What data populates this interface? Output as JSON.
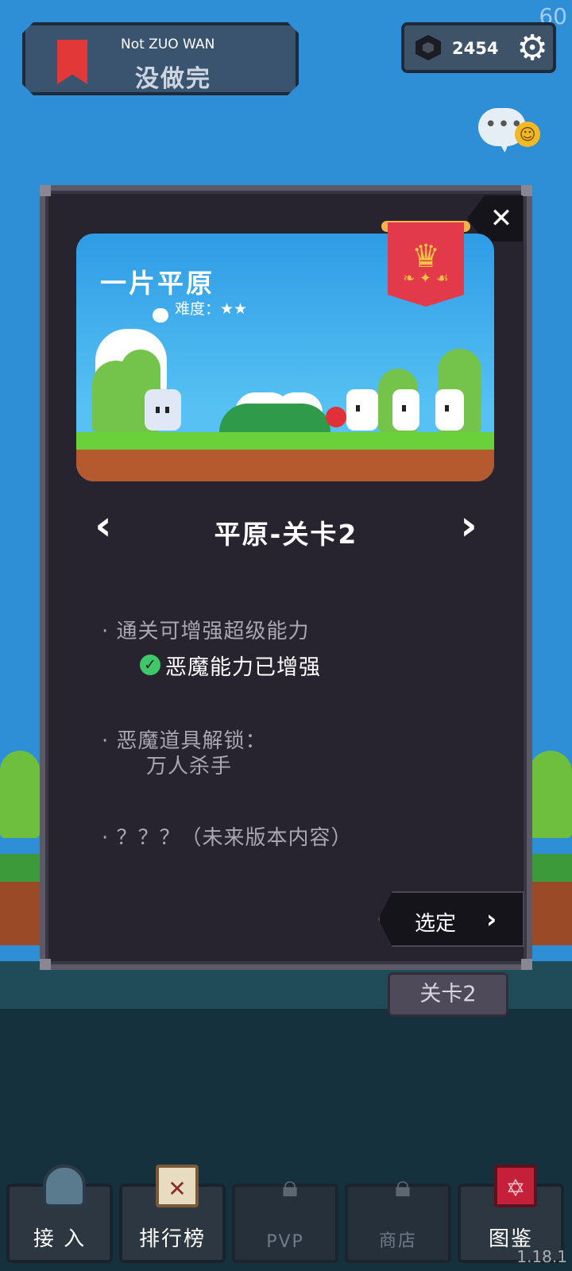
{
  "status": {
    "fps": "60",
    "version": "1.18.1"
  },
  "header": {
    "title_en": "Not ZUO WAN",
    "title_cn": "没做完",
    "bookmark_icon": "bookmark-icon",
    "currency": {
      "icon": "gem-icon",
      "amount": "2454"
    },
    "settings_icon": "gear-icon",
    "chat": {
      "dots": "•••",
      "emoji": "☺"
    }
  },
  "modal": {
    "close_label": "✕",
    "scene_title": "一片平原",
    "difficulty": "难度：★★",
    "badge_icon": "crown-banner-icon",
    "prev_label": "‹",
    "next_label": "›",
    "stage_name": "平原-关卡2",
    "rewards": [
      {
        "bullet": "· 通关可增强超级能力",
        "sub": "恶魔能力已增强"
      },
      {
        "bullet": "· 恶魔道具解锁：",
        "sub": "万人杀手"
      },
      {
        "bullet": "· ？？？（未来版本内容）",
        "sub": ""
      }
    ],
    "select_label": "选定",
    "select_chevron": "›"
  },
  "stage_tab": "关卡2",
  "bottom_nav": [
    {
      "label": "接 入",
      "icon": "helmet-icon",
      "locked": false
    },
    {
      "label": "排行榜",
      "icon": "scroll-icon",
      "locked": false
    },
    {
      "label": "PVP",
      "icon": "lock-icon",
      "locked": true
    },
    {
      "label": "商店",
      "icon": "lock-icon",
      "locked": true
    },
    {
      "label": "图鉴",
      "icon": "book-icon",
      "locked": false
    }
  ],
  "colors": {
    "sky": "#2f8fd6",
    "modal_bg": "#27232f",
    "accent_green": "#3fc86a",
    "banner_red": "#e23a4a"
  }
}
